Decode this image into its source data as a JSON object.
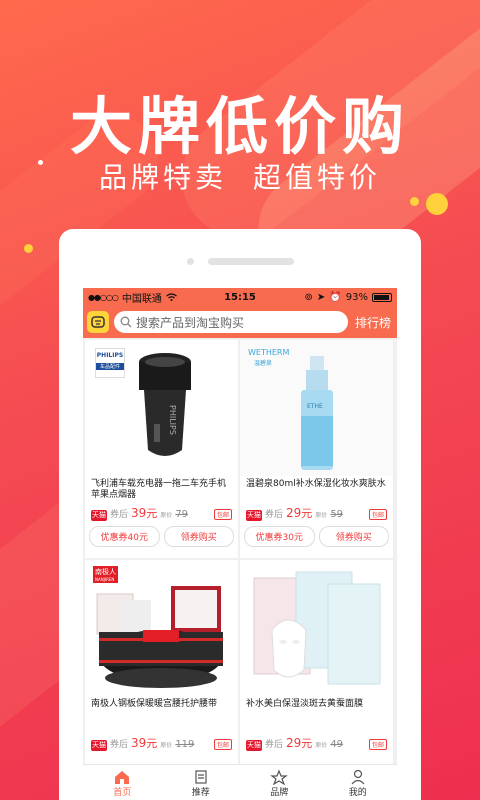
{
  "promo": {
    "headline": "大牌低价购",
    "sub_left": "品牌特卖",
    "sub_right": "超值特价"
  },
  "statusbar": {
    "carrier": "中国联通",
    "time": "15:15",
    "battery": "93%"
  },
  "search": {
    "placeholder": "搜索产品到淘宝购买",
    "rank_label": "排行榜"
  },
  "products": [
    {
      "title": "飞利浦车载充电器一拖二车充手机苹果点烟器",
      "brand_badge": "PHILIPS",
      "brand_sub": "车品配件",
      "after_coupon_label": "券后",
      "price": "39",
      "yuan": "元",
      "orig_label": "原价",
      "orig": "79",
      "tag": "包邮",
      "coupon_btn": "优惠券40元",
      "buy_btn": "领券购买"
    },
    {
      "title": "温碧泉80ml补水保湿化妆水爽肤水",
      "brand_badge": "WETHERM",
      "brand_sub": "温碧泉",
      "after_coupon_label": "券后",
      "price": "29",
      "yuan": "元",
      "orig_label": "原价",
      "orig": "59",
      "tag": "包邮",
      "coupon_btn": "优惠券30元",
      "buy_btn": "领券购买"
    },
    {
      "title": "南极人钢板保暖暖宫腰托护腰带",
      "brand_badge": "南极人",
      "brand_sub": "NANJIREN",
      "after_coupon_label": "券后",
      "price": "39",
      "yuan": "元",
      "orig_label": "原价",
      "orig": "119",
      "tag": "包邮",
      "coupon_btn": "",
      "buy_btn": ""
    },
    {
      "title": "补水美白保湿淡斑去黄蚕面膜",
      "brand_badge": "",
      "brand_sub": "",
      "after_coupon_label": "券后",
      "price": "29",
      "yuan": "元",
      "orig_label": "原价",
      "orig": "49",
      "tag": "包邮",
      "coupon_btn": "",
      "buy_btn": ""
    }
  ],
  "tmall_badge": "天猫",
  "tabs": [
    {
      "label": "首页",
      "icon": "home-icon"
    },
    {
      "label": "推荐",
      "icon": "recommend-icon"
    },
    {
      "label": "品牌",
      "icon": "brand-icon"
    },
    {
      "label": "我的",
      "icon": "profile-icon"
    }
  ],
  "colors": {
    "accent": "#f86b4e",
    "price": "#f03a3a",
    "highlight": "#ffd23b"
  }
}
